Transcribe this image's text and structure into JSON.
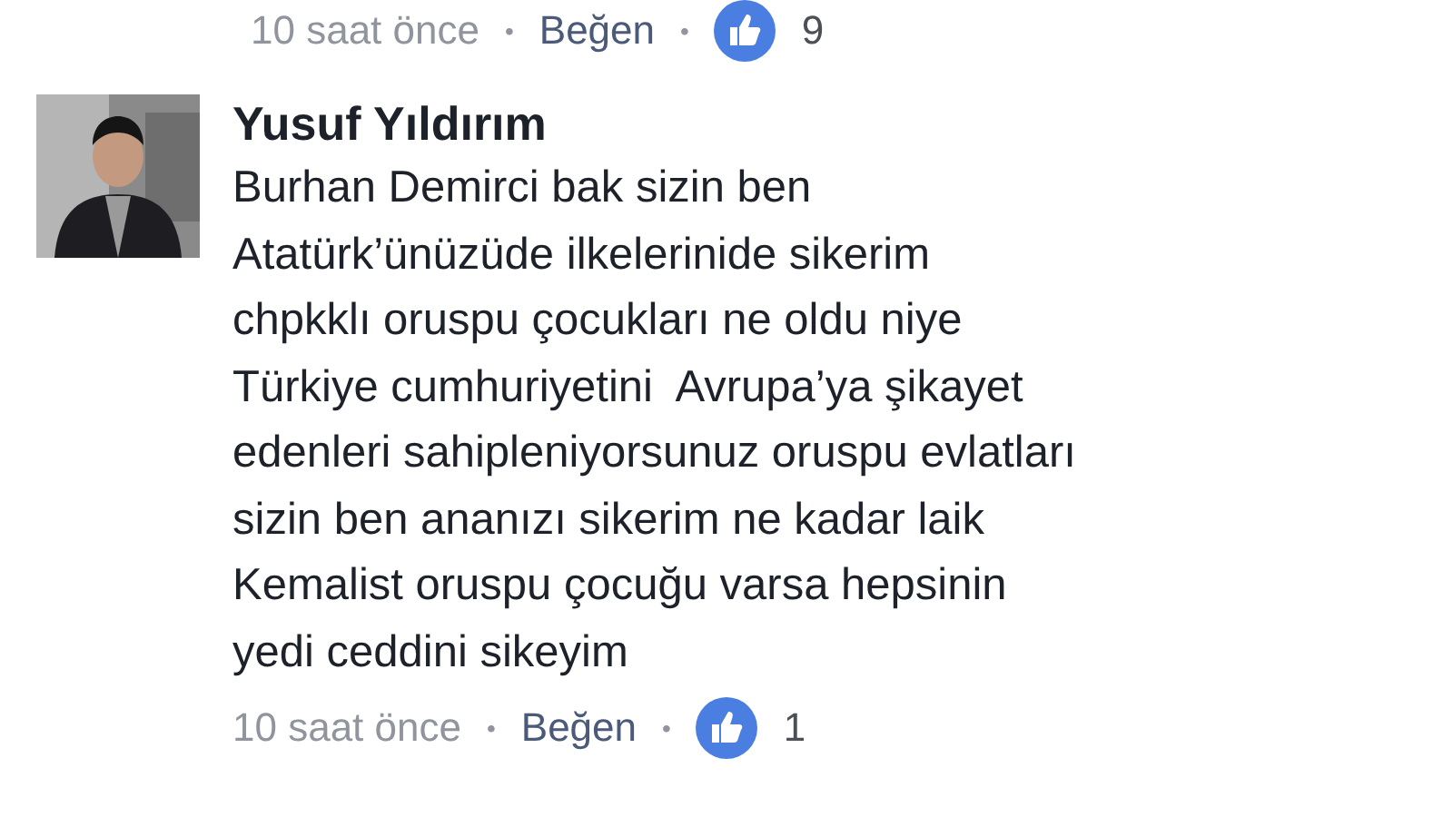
{
  "previous_comment": {
    "time": "10 saat önce",
    "separator": "•",
    "like_label": "Beğen",
    "like_count": "9"
  },
  "comment": {
    "author": "Yusuf Yıldırım",
    "text": "Burhan Demirci bak sizin ben\nAtatürk’ünüzüde ilkelerinide sikerim\nchpkklı oruspu çocukları ne oldu niye\nTürkiye cumhuriyetini  Avrupa’ya şikayet\nedenleri sahipleniyorsunuz oruspu evlatları\nsizin ben ananızı sikerim ne kadar laik\nKemalist oruspu çocuğu varsa hepsinin\nyedi ceddini sikeyim",
    "time": "10 saat önce",
    "separator": "•",
    "like_label": "Beğen",
    "like_count": "1"
  }
}
